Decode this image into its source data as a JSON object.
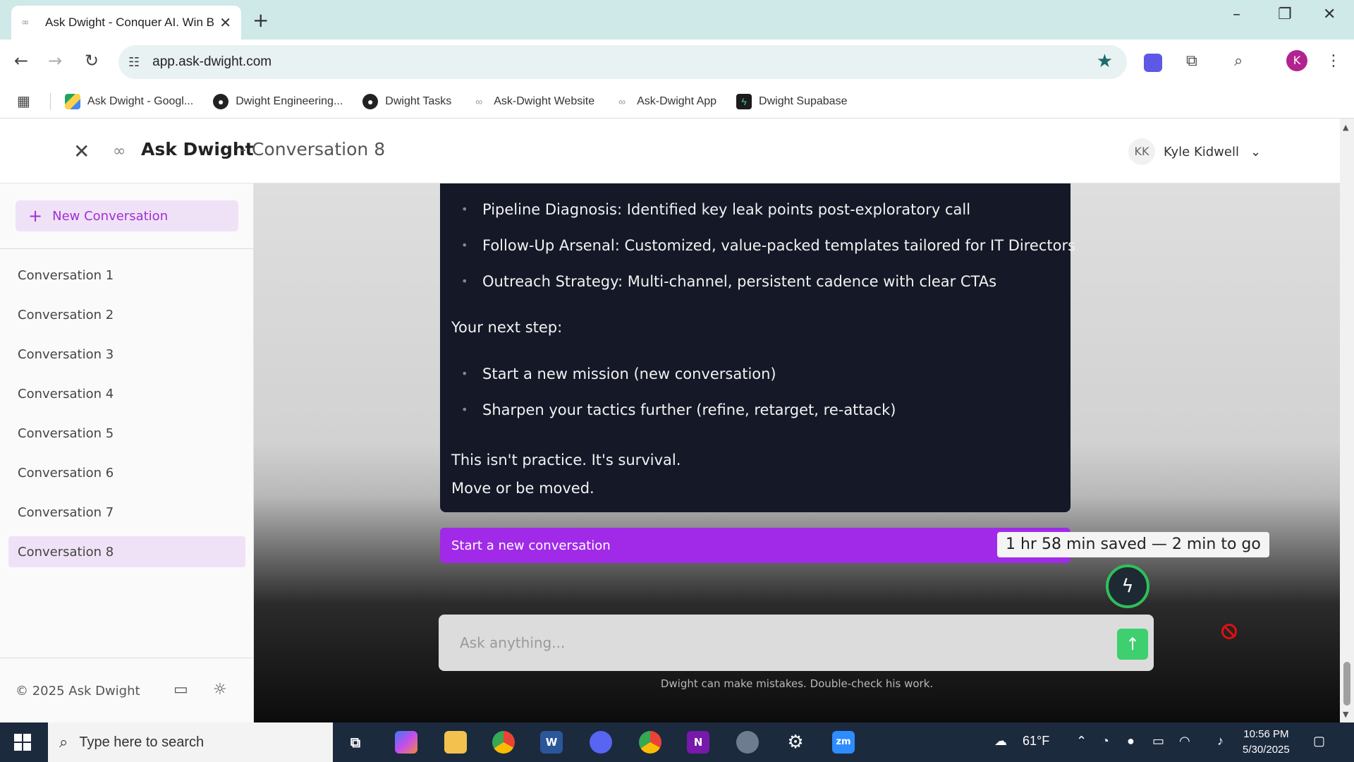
{
  "browser": {
    "tab_title": "Ask Dwight - Conquer AI. Win B",
    "url": "app.ask-dwight.com",
    "bookmarks": [
      {
        "label": "Ask Dwight - Googl...",
        "icon": "google-drive-icon"
      },
      {
        "label": "Dwight Engineering...",
        "icon": "github-icon"
      },
      {
        "label": "Dwight Tasks",
        "icon": "github-icon"
      },
      {
        "label": "Ask-Dwight Website",
        "icon": "dwight-logo-icon"
      },
      {
        "label": "Ask-Dwight App",
        "icon": "dwight-logo-icon"
      },
      {
        "label": "Dwight Supabase",
        "icon": "supabase-icon"
      }
    ],
    "profile_initial": "K"
  },
  "header": {
    "brand": "Ask Dwight",
    "conversation_title": "- Conversation 8",
    "user_initials": "KK",
    "user_name": "Kyle Kidwell"
  },
  "sidebar": {
    "new_conversation_label": "New Conversation",
    "conversations": [
      "Conversation 1",
      "Conversation 2",
      "Conversation 3",
      "Conversation 4",
      "Conversation 5",
      "Conversation 6",
      "Conversation 7",
      "Conversation 8"
    ],
    "active_conversation": "Conversation 8",
    "copyright": "© 2025 Ask Dwight"
  },
  "message": {
    "summary_bullets": [
      "Pipeline Diagnosis: Identified key leak points post-exploratory call",
      "Follow-Up Arsenal: Customized, value-packed templates tailored for IT Directors",
      "Outreach Strategy: Multi-channel, persistent cadence with clear CTAs"
    ],
    "next_step_heading": "Your next step:",
    "next_step_bullets": [
      "Start a new mission (new conversation)",
      "Sharpen your tactics further (refine, retarget, re-attack)"
    ],
    "closing_line_1": "This isn't practice. It's survival.",
    "closing_line_2": "Move or be moved."
  },
  "main": {
    "start_new_label": "Start a new conversation",
    "time_saved": "1 hr 58 min saved — 2 min to go",
    "input_placeholder": "Ask anything...",
    "disclaimer": "Dwight can make mistakes. Double-check his work."
  },
  "taskbar": {
    "search_placeholder": "Type here to search",
    "weather": "61°F",
    "time": "10:56 PM",
    "date": "5/30/2025"
  },
  "colors": {
    "accent_purple": "#a12ae8",
    "message_bg": "#141827",
    "send_green": "#3ecf6e",
    "active_item_bg": "#f0e2f6"
  }
}
